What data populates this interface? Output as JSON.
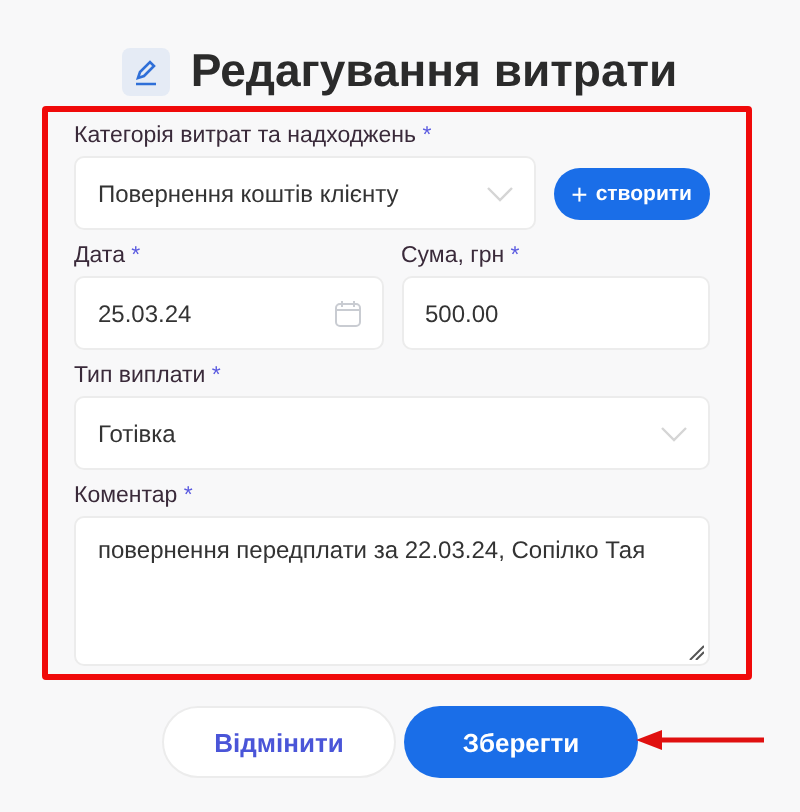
{
  "title": "Редагування витрати",
  "category": {
    "label": "Категорія витрат та надходжень",
    "mark": "*",
    "value": "Повернення коштів клієнту"
  },
  "create_button": {
    "icon": "+",
    "label": "створити"
  },
  "date": {
    "label": "Дата",
    "mark": "*",
    "value": "25.03.24"
  },
  "amount": {
    "label": "Сума, грн",
    "mark": "*",
    "value": "500.00"
  },
  "payment_type": {
    "label": "Тип виплати",
    "mark": "*",
    "value": "Готівка"
  },
  "comment": {
    "label": "Коментар",
    "mark": "*",
    "value": "повернення передплати за 22.03.24, Сопілко Тая"
  },
  "buttons": [
    {
      "kind": "secondary",
      "label": "Відмінити"
    },
    {
      "kind": "primary",
      "label": "Зберегти"
    }
  ]
}
